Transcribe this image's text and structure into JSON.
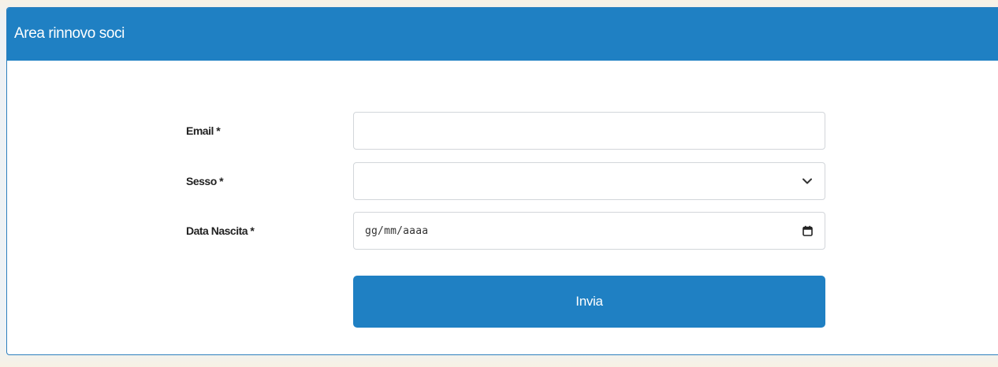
{
  "panel": {
    "title": "Area rinnovo soci"
  },
  "form": {
    "email": {
      "label": "Email *",
      "value": "",
      "placeholder": ""
    },
    "sesso": {
      "label": "Sesso *",
      "selected": ""
    },
    "data_nascita": {
      "label": "Data Nascita *",
      "placeholder": "gg/mm/aaaa"
    },
    "submit_label": "Invia"
  },
  "colors": {
    "header_bg": "#1f80c3",
    "button_bg": "#1f80c3",
    "panel_border": "#2d7fbd",
    "field_border": "#d2d6da"
  },
  "icons": {
    "select": "chevron-down-icon",
    "date": "calendar-icon"
  }
}
